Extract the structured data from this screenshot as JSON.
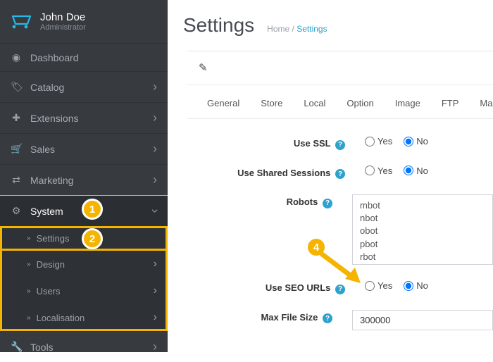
{
  "user": {
    "name": "John Doe",
    "role": "Administrator"
  },
  "nav": {
    "items": [
      {
        "label": "Dashboard"
      },
      {
        "label": "Catalog"
      },
      {
        "label": "Extensions"
      },
      {
        "label": "Sales"
      },
      {
        "label": "Marketing"
      },
      {
        "label": "System"
      },
      {
        "label": "Tools"
      }
    ],
    "system_sub": [
      {
        "label": "Settings"
      },
      {
        "label": "Design"
      },
      {
        "label": "Users"
      },
      {
        "label": "Localisation"
      }
    ]
  },
  "page": {
    "title": "Settings"
  },
  "breadcrumb": {
    "home": "Home",
    "sep": "/",
    "current": "Settings"
  },
  "tabs": [
    "General",
    "Store",
    "Local",
    "Option",
    "Image",
    "FTP",
    "Ma"
  ],
  "form": {
    "use_ssl": {
      "label": "Use SSL",
      "yes": "Yes",
      "no": "No",
      "value": "No"
    },
    "use_shared": {
      "label": "Use Shared Sessions",
      "yes": "Yes",
      "no": "No",
      "value": "No"
    },
    "robots": {
      "label": "Robots",
      "value": "mbot\nnbot\nobot\npbot\nrbot\nsbot"
    },
    "use_seo": {
      "label": "Use SEO URLs",
      "yes": "Yes",
      "no": "No",
      "value": "No"
    },
    "max_file": {
      "label": "Max File Size",
      "value": "300000"
    }
  },
  "annot": {
    "b1": "1",
    "b2": "2",
    "b4": "4"
  }
}
